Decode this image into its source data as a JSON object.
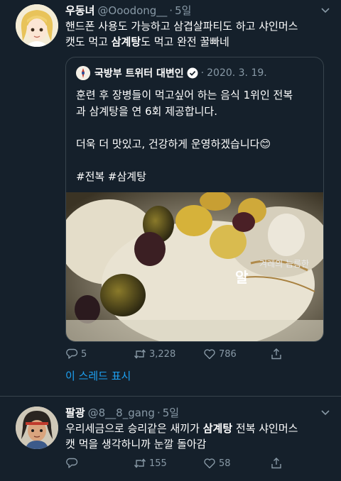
{
  "tweets": [
    {
      "author": {
        "name": "우동녀",
        "handle": "@Ooodong__",
        "time": "5일"
      },
      "text_line1": "핸드폰 사용도 가능하고 삼겹살파티도 하고 샤인머스",
      "text_line2_pre": "캣도 먹고 ",
      "text_line2_highlight": "삼계탕",
      "text_line2_post": "도 먹고 완전 꿀빠네",
      "quote": {
        "author": "국방부 트위터 대변인",
        "date": "2020. 3. 19.",
        "line1": "훈련 후 장병들이 먹고싶어 하는 음식 1위인 전복",
        "line2": "과 삼계탕을 연 6회 제공합니다.",
        "line3": "더욱 더 맛있고, 건강하게 운영하겠습니다😊",
        "hashtags": "#전복 #삼계탕",
        "image_caption_small": "겨레의 늠름한",
        "image_caption_big": "알"
      },
      "stats": {
        "replies": "5",
        "retweets": "3,228",
        "likes": "786"
      },
      "thread_link": "이 스레드 표시"
    },
    {
      "author": {
        "name": "팔광",
        "handle": "@8__8_gang",
        "time": "5일"
      },
      "text_line1_pre": "우리세금으로 승리같은 새끼가 ",
      "text_line1_highlight": "삼계탕",
      "text_line1_post": " 전복 샤인머스",
      "text_line2": "캣 먹을 생각하니까 눈깔 돌아감",
      "stats": {
        "replies": "",
        "retweets": "155",
        "likes": "58"
      }
    }
  ],
  "colors": {
    "background": "#15202b",
    "secondary_text": "#8899a6",
    "link": "#1da1f2",
    "border": "#38444d"
  }
}
